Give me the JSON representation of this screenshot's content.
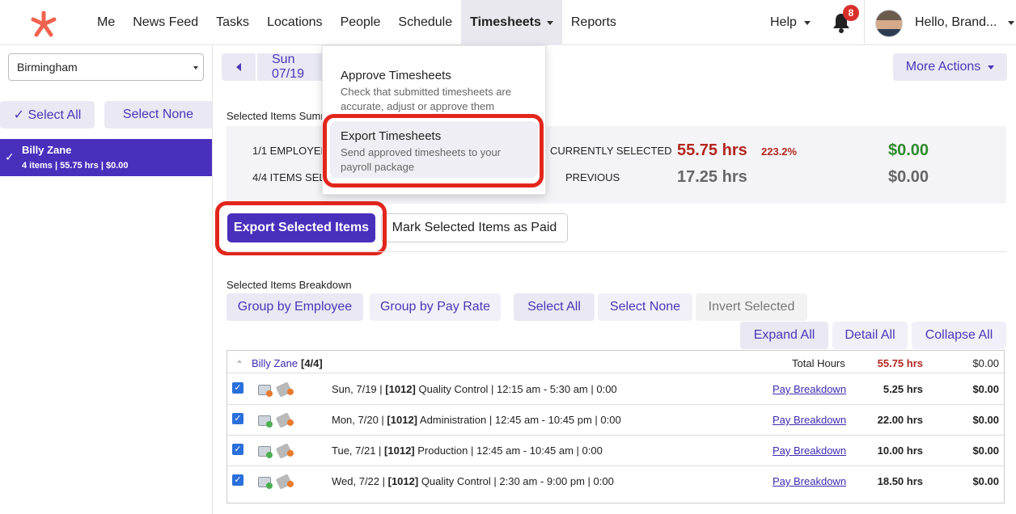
{
  "nav": {
    "items": [
      "Me",
      "News Feed",
      "Tasks",
      "Locations",
      "People",
      "Schedule",
      "Timesheets",
      "Reports"
    ],
    "active": "Timesheets",
    "help": "Help",
    "notification_count": "8",
    "greeting": "Hello, Brand..."
  },
  "sidebar": {
    "location": "Birmingham",
    "select_all": "✓ Select All",
    "select_none": "Select None",
    "employee": {
      "name": "Billy Zane",
      "meta": "4 items | 55.75 hrs | $0.00"
    }
  },
  "date_bar": {
    "date": "Sun 07/19",
    "more_actions": "More Actions"
  },
  "summary": {
    "label": "Selected Items Summary",
    "employees": "1/1 EMPLOYEES",
    "items": "4/4 ITEMS SELECTED",
    "currently": "CURRENTLY SELECTED",
    "previous": "PREVIOUS",
    "current_hrs": "55.75 hrs",
    "pct": "223.2%",
    "current_cost": "$0.00",
    "previous_hrs": "17.25 hrs",
    "previous_cost": "$0.00"
  },
  "actions": {
    "export": "Export Selected Items",
    "mark_paid": "Mark Selected Items as Paid"
  },
  "breakdown": {
    "label": "Selected Items Breakdown",
    "group_employee": "Group by Employee",
    "group_pay": "Group by Pay Rate",
    "select_all": "Select All",
    "select_none": "Select None",
    "invert": "Invert Selected",
    "expand_all": "Expand All",
    "detail_all": "Detail All",
    "collapse_all": "Collapse All"
  },
  "table": {
    "employee": "Billy Zane",
    "count": "[4/4]",
    "total_label": "Total Hours",
    "total_hrs": "55.75 hrs",
    "total_cost": "$0.00",
    "rows": [
      {
        "date": "Sun, 7/19 | ",
        "code": "[1012]",
        "rest": " Quality Control | 12:15 am - 5:30 am | 0:00",
        "link": "Pay Breakdown",
        "hrs": "5.25 hrs",
        "cost": "$0.00"
      },
      {
        "date": "Mon, 7/20 | ",
        "code": "[1012]",
        "rest": " Administration | 12:45 am - 10:45 pm | 0:00",
        "link": "Pay Breakdown",
        "hrs": "22.00 hrs",
        "cost": "$0.00"
      },
      {
        "date": "Tue, 7/21 | ",
        "code": "[1012]",
        "rest": " Production | 12:45 am - 10:45 am | 0:00",
        "link": "Pay Breakdown",
        "hrs": "10.00 hrs",
        "cost": "$0.00"
      },
      {
        "date": "Wed, 7/22 | ",
        "code": "[1012]",
        "rest": " Quality Control | 2:30 am - 9:00 pm | 0:00",
        "link": "Pay Breakdown",
        "hrs": "18.50 hrs",
        "cost": "$0.00"
      }
    ]
  },
  "dropdown": {
    "approve_title": "Approve Timesheets",
    "approve_desc": "Check that submitted timesheets are accurate, adjust or approve them",
    "export_title": "Export Timesheets",
    "export_desc": "Send approved timesheets to your payroll package"
  },
  "colors": {
    "brand": "#4a2fbd",
    "accent_light": "#e9e8f3",
    "highlight_ring": "#e2261c",
    "logo": "#f0634f"
  }
}
